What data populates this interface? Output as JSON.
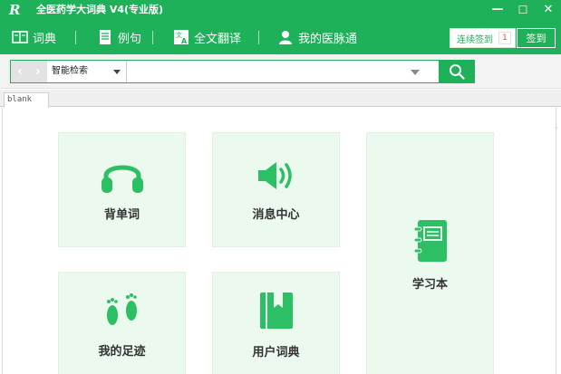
{
  "titlebar": {
    "logo": "R",
    "title": "全医药学大词典 V4(专业版)",
    "minimize": "—",
    "maximize": "☐",
    "close": "✕"
  },
  "nav": {
    "items": [
      {
        "label": "词典",
        "icon": "book-icon"
      },
      {
        "label": "例句",
        "icon": "document-icon"
      },
      {
        "label": "全文翻译",
        "icon": "translate-icon"
      },
      {
        "label": "我的医脉通",
        "icon": "user-icon"
      }
    ],
    "streak_label": "连续签到",
    "streak_count": "1",
    "checkin_label": "签到"
  },
  "search": {
    "mode": "智能检索",
    "value": "",
    "back": "‹",
    "forward": "›",
    "tools": [
      "translate-cancel-icon",
      "spellcheck-cancel-icon",
      "notes-edit-icon"
    ]
  },
  "tabs": [
    {
      "label": "blank"
    }
  ],
  "tiles": [
    {
      "label": "背单词",
      "icon": "headphones-icon"
    },
    {
      "label": "消息中心",
      "icon": "speaker-icon"
    },
    {
      "label": "学习本",
      "icon": "notebook-icon"
    },
    {
      "label": "我的足迹",
      "icon": "footprints-icon"
    },
    {
      "label": "用户词典",
      "icon": "bookmark-book-icon"
    }
  ],
  "colors": {
    "brand": "#1fb05a",
    "tile_bg": "#ecf9ef",
    "icon": "#2cbf63",
    "badge_red": "#f04a3c"
  }
}
